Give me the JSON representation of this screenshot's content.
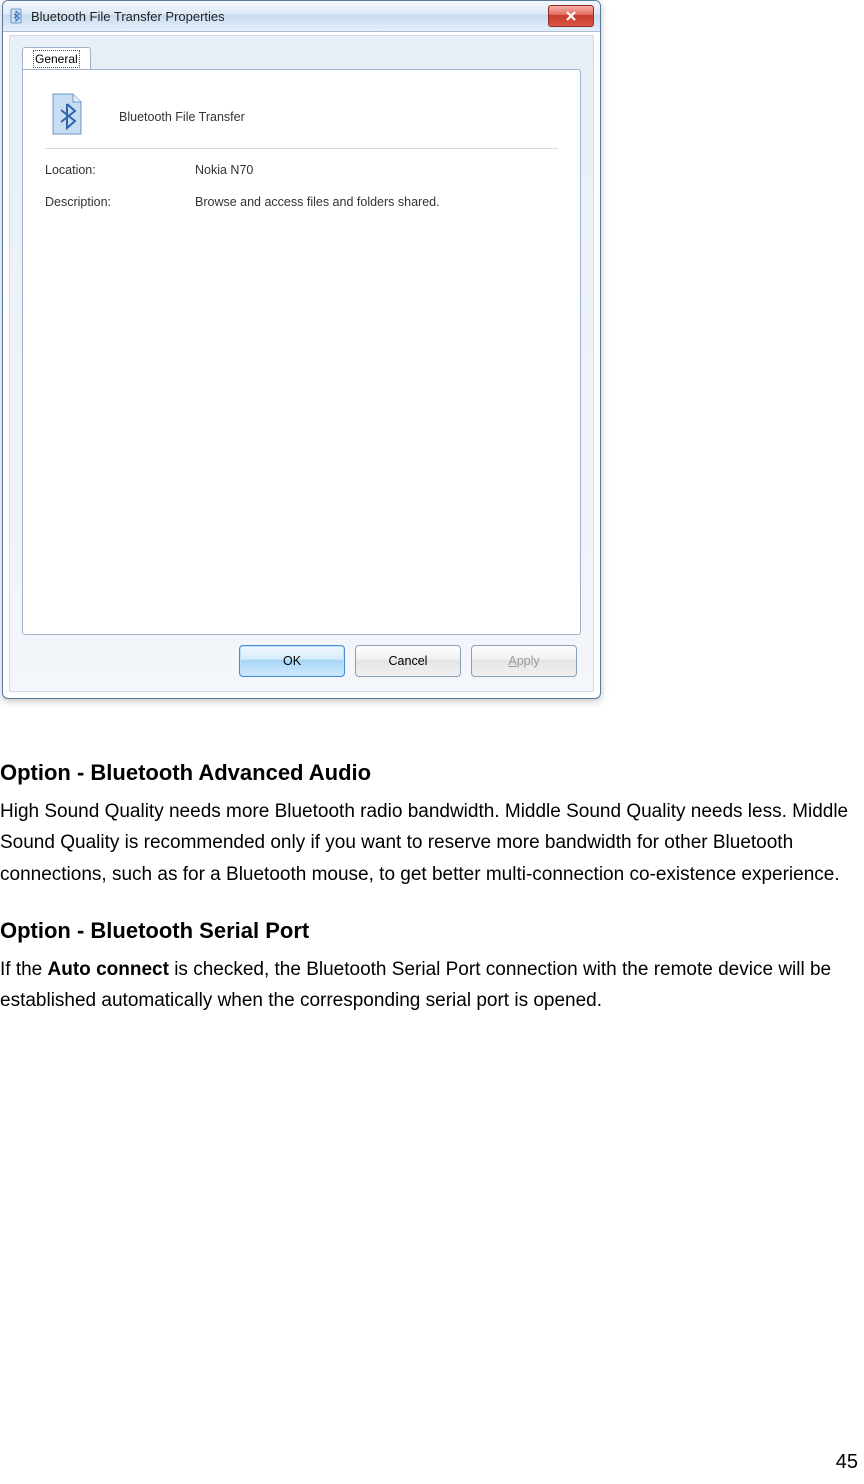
{
  "dialog": {
    "title": "Bluetooth File Transfer Properties",
    "tab_label": "General",
    "service_name": "Bluetooth File Transfer",
    "location_label": "Location:",
    "location_value": "Nokia N70",
    "description_label": "Description:",
    "description_value": "Browse and access files and folders shared.",
    "ok_label": "OK",
    "cancel_label": "Cancel",
    "apply_label_prefix": "A",
    "apply_label_suffix": "pply"
  },
  "doc": {
    "section1_heading": "Option - Bluetooth Advanced Audio",
    "section1_body": "High Sound Quality needs more Bluetooth radio bandwidth. Middle Sound Quality needs less. Middle Sound Quality is recommended only if you want to reserve more bandwidth for other Bluetooth connections, such as for a Bluetooth mouse, to get better multi-connection co-existence experience.",
    "section2_heading": "Option - Bluetooth Serial Port",
    "section2_body_before": "If the ",
    "section2_body_bold": "Auto connect",
    "section2_body_after": " is checked, the Bluetooth Serial Port connection with the remote device will be established automatically when the corresponding serial port is opened."
  },
  "page_number": "45"
}
